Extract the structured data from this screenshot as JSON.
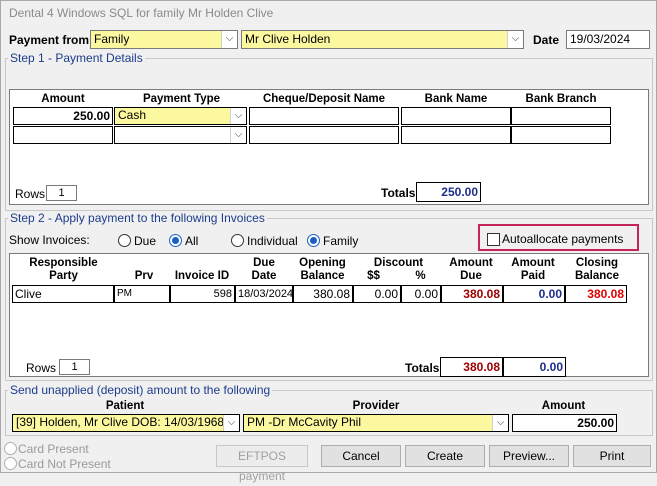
{
  "window": {
    "title": "Dental 4 Windows SQL for family Mr  Holden  Clive"
  },
  "header": {
    "payment_from_label": "Payment from",
    "payment_from_value": "Family",
    "payer_value": "Mr Clive  Holden",
    "date_label": "Date",
    "date_value": "19/03/2024"
  },
  "step1": {
    "title": "Step 1 - Payment Details",
    "columns": [
      "Amount",
      "Payment Type",
      "Cheque/Deposit Name",
      "Bank Name",
      "Bank Branch"
    ],
    "row1": {
      "amount": "250.00",
      "payment_type": "Cash"
    },
    "rows_label": "Rows",
    "rows_value": "1",
    "totals_label": "Totals",
    "totals_value": "250.00"
  },
  "step2": {
    "title": "Step 2 - Apply payment to the following Invoices",
    "show_invoices_label": "Show Invoices:",
    "radio_due": "Due",
    "radio_all": "All",
    "radio_individual": "Individual",
    "radio_family": "Family",
    "autoallocate_label": "Autoallocate payments",
    "headers": {
      "responsible_party": [
        "Responsible",
        "Party"
      ],
      "prv": "Prv",
      "invoice_id": "Invoice ID",
      "due_date": [
        "Due",
        "Date"
      ],
      "opening_balance": [
        "Opening",
        "Balance"
      ],
      "discount": "Discount",
      "discount_dollar": "$$",
      "discount_pct": "%",
      "amount_due": [
        "Amount",
        "Due"
      ],
      "amount_paid": [
        "Amount",
        "Paid"
      ],
      "closing_balance": [
        "Closing",
        "Balance"
      ]
    },
    "row": {
      "party": "Clive",
      "prv": "PM",
      "invoice_id": "598",
      "due_date": "18/03/2024",
      "opening_balance": "380.08",
      "discount_dollar": "0.00",
      "discount_pct": "0.00",
      "amount_due": "380.08",
      "amount_paid": "0.00",
      "closing_balance": "380.08"
    },
    "rows_label": "Rows",
    "rows_value": "1",
    "totals_label": "Totals",
    "totals_due": "380.08",
    "totals_paid": "0.00"
  },
  "unapplied": {
    "title": "Send unapplied (deposit) amount to the following",
    "patient_label": "Patient",
    "provider_label": "Provider",
    "amount_label": "Amount",
    "patient_value": "[39] Holden, Mr Clive DOB: 14/03/1968",
    "provider_value": "PM -Dr McCavity Phil",
    "amount_value": "250.00"
  },
  "footer": {
    "card_present": "Card Present",
    "card_not_present": "Card Not Present",
    "eftpos": "EFTPOS payment",
    "cancel": "Cancel",
    "create": "Create",
    "preview": "Preview...",
    "print": "Print"
  },
  "colors": {
    "highlight_yellow": "#fcf8a0",
    "autoallocate_border": "#c8245c",
    "group_title": "#1c3c8c",
    "due_red": "#a00000"
  }
}
